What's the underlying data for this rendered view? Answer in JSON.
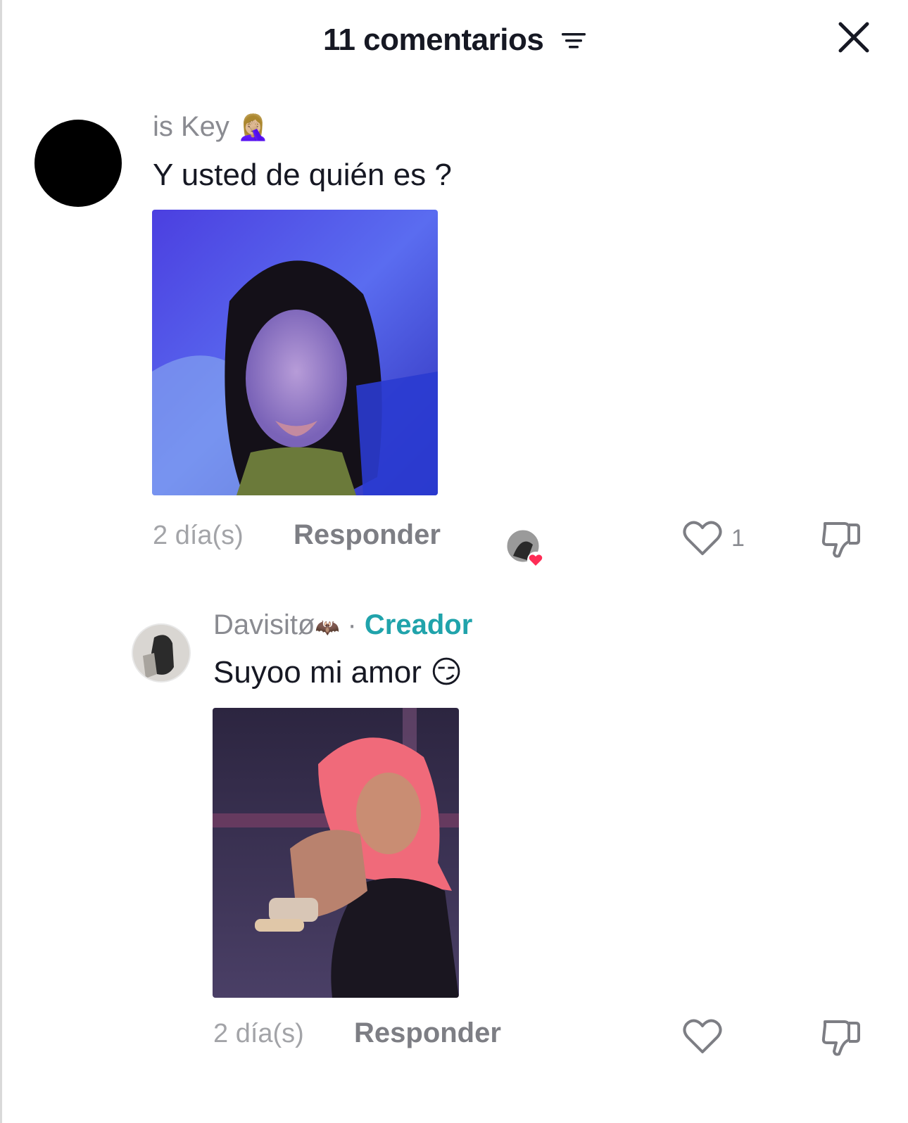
{
  "header": {
    "title": "11 comentarios",
    "filter_icon": "filter-icon",
    "close_icon": "close-icon"
  },
  "comments": [
    {
      "username": "is Key",
      "username_emoji": "🤦🏼‍♀️",
      "text": "Y usted de quién es ?",
      "time": "2 día(s)",
      "reply_label": "Responder",
      "like_count": "1",
      "creator_liked": true
    },
    {
      "username": "Davisitø",
      "username_emoji": "🦇",
      "separator": "·",
      "badge": "Creador",
      "text": "Suyoo mi amor",
      "text_emoji": "😏",
      "time": "2 día(s)",
      "reply_label": "Responder",
      "like_count": ""
    }
  ],
  "colors": {
    "creator": "#20a3ab",
    "muted": "#8a8b91",
    "liked_heart": "#fe2c55"
  }
}
